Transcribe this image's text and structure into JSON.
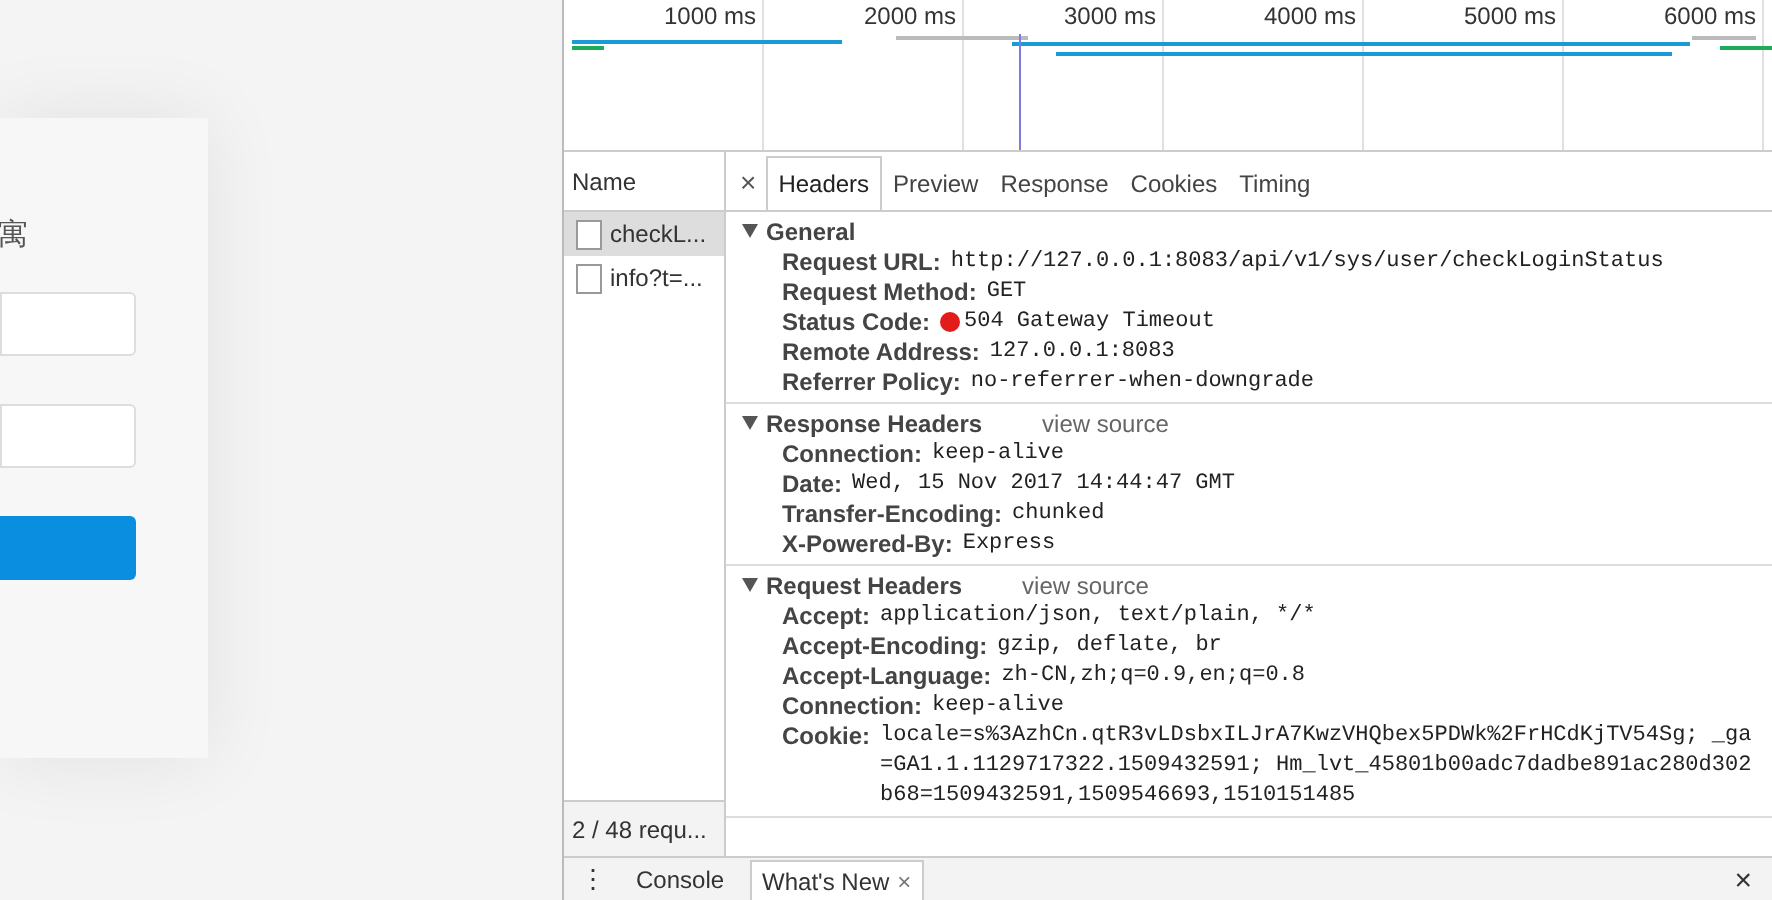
{
  "page": {
    "title": "寓"
  },
  "timeline": {
    "ticks": [
      "1000 ms",
      "2000 ms",
      "3000 ms",
      "4000 ms",
      "5000 ms",
      "6000 ms"
    ]
  },
  "requests": {
    "column": "Name",
    "items": [
      {
        "name": "checkL...",
        "selected": true
      },
      {
        "name": "info?t=...",
        "selected": false
      }
    ],
    "footer": "2 / 48 requ..."
  },
  "detail_tabs": {
    "close": "×",
    "tabs": [
      {
        "label": "Headers",
        "selected": true
      },
      {
        "label": "Preview",
        "selected": false
      },
      {
        "label": "Response",
        "selected": false
      },
      {
        "label": "Cookies",
        "selected": false
      },
      {
        "label": "Timing",
        "selected": false
      }
    ]
  },
  "sections": [
    {
      "title": "General",
      "rows": [
        {
          "key": "Request URL:",
          "value": "http://127.0.0.1:8083/api/v1/sys/user/checkLoginStatus",
          "error": false
        },
        {
          "key": "Request Method:",
          "value": "GET",
          "error": false
        },
        {
          "key": "Status Code:",
          "value": "504 Gateway Timeout",
          "error": true
        },
        {
          "key": "Remote Address:",
          "value": "127.0.0.1:8083",
          "error": false
        },
        {
          "key": "Referrer Policy:",
          "value": "no-referrer-when-downgrade",
          "error": false
        }
      ]
    },
    {
      "title": "Response Headers",
      "link": "view source",
      "rows": [
        {
          "key": "Connection:",
          "value": "keep-alive",
          "error": false
        },
        {
          "key": "Date:",
          "value": "Wed, 15 Nov 2017 14:44:47 GMT",
          "error": false
        },
        {
          "key": "Transfer-Encoding:",
          "value": "chunked",
          "error": false
        },
        {
          "key": "X-Powered-By:",
          "value": "Express",
          "error": false
        }
      ]
    },
    {
      "title": "Request Headers",
      "link": "view source",
      "rows": [
        {
          "key": "Accept:",
          "value": "application/json, text/plain, */*",
          "error": false
        },
        {
          "key": "Accept-Encoding:",
          "value": "gzip, deflate, br",
          "error": false
        },
        {
          "key": "Accept-Language:",
          "value": "zh-CN,zh;q=0.9,en;q=0.8",
          "error": false
        },
        {
          "key": "Connection:",
          "value": "keep-alive",
          "error": false
        },
        {
          "key": "Cookie:",
          "value": "locale=s%3AzhCn.qtR3vLDsbxILJrA7KwzVHQbex5PDWk%2FrHCdKjTV54Sg; _ga=GA1.1.1129717322.1509432591; Hm_lvt_45801b00adc7dadbe891ac280d302b68=1509432591,1509546693,1510151485",
          "error": false
        }
      ]
    }
  ],
  "drawer": {
    "menu": "⋮",
    "tabs": [
      {
        "label": "Console",
        "selected": false
      },
      {
        "label": "What's New",
        "selected": true
      }
    ],
    "tab_close": "×",
    "close": "×"
  }
}
